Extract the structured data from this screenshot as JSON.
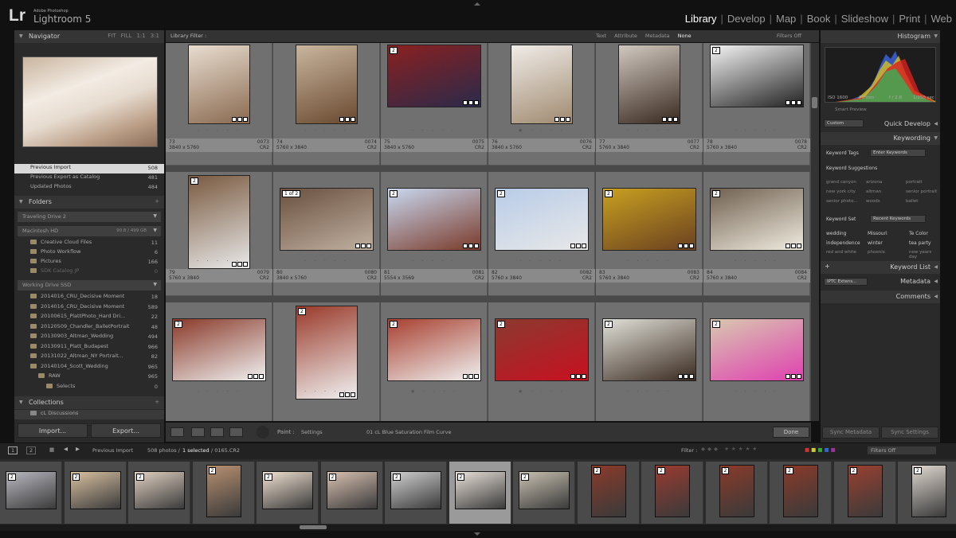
{
  "app": {
    "logo": "Lr",
    "brand": "Adobe Photoshop",
    "product": "Lightroom 5"
  },
  "modules": [
    {
      "label": "Library",
      "active": true
    },
    {
      "label": "Develop"
    },
    {
      "label": "Map"
    },
    {
      "label": "Book"
    },
    {
      "label": "Slideshow"
    },
    {
      "label": "Print"
    },
    {
      "label": "Web"
    }
  ],
  "navigator": {
    "title": "Navigator",
    "zoom": [
      "FIT",
      "FILL",
      "1:1",
      "3:1"
    ]
  },
  "catalog": {
    "items": [
      {
        "label": "Previous Import",
        "count": "508"
      },
      {
        "label": "Previous Export as Catalog",
        "count": "481"
      },
      {
        "label": "Updated Photos",
        "count": "484"
      }
    ]
  },
  "folders": {
    "title": "Folders",
    "drives": [
      {
        "label": "Traveling Drive 2"
      },
      {
        "label": "Macintosh HD",
        "space": "90.8 / 499 GB"
      },
      {
        "label": "Working Drive SSD"
      }
    ],
    "hd_items": [
      {
        "label": "Creative Cloud Files",
        "count": "11"
      },
      {
        "label": "Photo Workflow",
        "count": "6"
      },
      {
        "label": "Pictures",
        "count": "166"
      },
      {
        "label": "SDK Catalog JP",
        "count": "0"
      }
    ],
    "ssd_items": [
      {
        "label": "2014016_CRU_Decisive Moment",
        "count": "18"
      },
      {
        "label": "2014016_CRU_Decisive Moment",
        "count": "589"
      },
      {
        "label": "20100615_PlattPhoto_Hard Dri...",
        "count": "22"
      },
      {
        "label": "20120509_Chandler_BalletPortrait",
        "count": "48"
      },
      {
        "label": "20130903_Altman_Wedding",
        "count": "494"
      },
      {
        "label": "20130911_Platt_Budapest",
        "count": "966"
      },
      {
        "label": "20131022_Altman_NY Portrait...",
        "count": "82"
      },
      {
        "label": "20140104_Scott_Wedding",
        "count": "965"
      },
      {
        "label": "RAW",
        "count": "965"
      },
      {
        "label": "Selects",
        "count": "0"
      }
    ]
  },
  "collections": {
    "title": "Collections",
    "items": [
      {
        "label": "cL Discussions"
      }
    ]
  },
  "buttons": {
    "import": "Import...",
    "export": "Export...",
    "done": "Done",
    "sync_metadata": "Sync Metadata",
    "sync_settings": "Sync Settings"
  },
  "filter": {
    "label": "Library Filter :",
    "options": [
      "Text",
      "Attribute",
      "Metadata",
      "None"
    ],
    "filters_off": "Filters Off"
  },
  "grid": [
    {
      "idx": "73",
      "dims": "3840 x 5760",
      "num": "0073",
      "ext": "CR2",
      "badge": "",
      "stars": "· · · · ·"
    },
    {
      "idx": "74",
      "dims": "5760 x 3840",
      "num": "0074",
      "ext": "CR2",
      "badge": "",
      "stars": "· · · · ·"
    },
    {
      "idx": "75",
      "dims": "3840 x 5760",
      "num": "0075",
      "ext": "CR2",
      "badge": "2",
      "stars": "· · · · ·"
    },
    {
      "idx": "76",
      "dims": "3840 x 5760",
      "num": "0076",
      "ext": "CR2",
      "badge": "",
      "stars": "★ · · · ·"
    },
    {
      "idx": "77",
      "dims": "5760 x 3840",
      "num": "0077",
      "ext": "CR2",
      "badge": "",
      "stars": "· · · · ·"
    },
    {
      "idx": "78",
      "dims": "5760 x 3840",
      "num": "0078",
      "ext": "CR2",
      "badge": "2",
      "stars": "· · · · ·"
    },
    {
      "idx": "79",
      "dims": "5760 x 3840",
      "num": "0079",
      "ext": "CR2",
      "badge": "2",
      "stars": "· · · · ·"
    },
    {
      "idx": "80",
      "dims": "3840 x 5760",
      "num": "0080",
      "ext": "CR2",
      "badge": "1 of 2",
      "stars": "· · · · ·"
    },
    {
      "idx": "81",
      "dims": "5554 x 3569",
      "num": "0081",
      "ext": "CR2",
      "badge": "2",
      "stars": "· · · · ·"
    },
    {
      "idx": "82",
      "dims": "5760 x 3840",
      "num": "0082",
      "ext": "CR2",
      "badge": "2",
      "stars": "· · · · ·"
    },
    {
      "idx": "83",
      "dims": "5760 x 3840",
      "num": "0083",
      "ext": "CR2",
      "badge": "2",
      "stars": "· · · · ·"
    },
    {
      "idx": "84",
      "dims": "5760 x 3840",
      "num": "0084",
      "ext": "CR2",
      "badge": "2",
      "stars": "· · · · ·"
    },
    {
      "idx": "",
      "dims": "",
      "num": "",
      "ext": "",
      "badge": "2",
      "stars": "· · · · ·"
    },
    {
      "idx": "",
      "dims": "",
      "num": "",
      "ext": "",
      "badge": "2",
      "stars": "· · · · ·"
    },
    {
      "idx": "",
      "dims": "",
      "num": "",
      "ext": "",
      "badge": "2",
      "stars": "★ · · · ·"
    },
    {
      "idx": "",
      "dims": "",
      "num": "",
      "ext": "",
      "badge": "2",
      "stars": "★ · · · ·"
    },
    {
      "idx": "",
      "dims": "",
      "num": "",
      "ext": "",
      "badge": "2",
      "stars": "· · · · ·"
    },
    {
      "idx": "",
      "dims": "",
      "num": "",
      "ext": "",
      "badge": "2",
      "stars": "· · · · ·"
    }
  ],
  "toolbar": {
    "paint": "Paint :",
    "settings": "Settings",
    "preset": "01 cL Blue Saturation Film Curve"
  },
  "histogram": {
    "title": "Histogram",
    "iso": "ISO 1600",
    "focal": "70 mm",
    "aperture": "f / 2.8",
    "shutter": "1/250 sec",
    "smart_preview": "Smart Preview"
  },
  "quick_develop": {
    "title": "Quick Develop",
    "preset": "Custom"
  },
  "keywording": {
    "title": "Keywording",
    "tags_label": "Keyword Tags",
    "tags_mode": "Enter Keywords",
    "suggestions_title": "Keyword Suggestions",
    "suggestions": [
      "grand canyon",
      "arizona",
      "portrait",
      "new york city",
      "altman",
      "senior portrait",
      "senior photo...",
      "woods",
      "ballet"
    ],
    "set_label": "Keyword Set",
    "set_value": "Recent Keywords",
    "set": [
      "wedding",
      "Missouri",
      "Te Color",
      "independence",
      "winter",
      "tea party",
      "red and white",
      "phoenix",
      "new years day"
    ]
  },
  "keyword_list": {
    "title": "Keyword List"
  },
  "metadata": {
    "title": "Metadata",
    "preset": "IPTC Extens..."
  },
  "comments": {
    "title": "Comments"
  },
  "filmstrip": {
    "pages": [
      "1",
      "2"
    ],
    "source": "Previous Import",
    "count": "508 photos /",
    "selected": "1 selected",
    "file": "/ 0165.CR2",
    "filter_label": "Filter :",
    "filters_off": "Filters Off"
  },
  "colors": {
    "accent": "#ffffff",
    "panel": "#2a2a2a",
    "grid_cell": "#707070"
  }
}
